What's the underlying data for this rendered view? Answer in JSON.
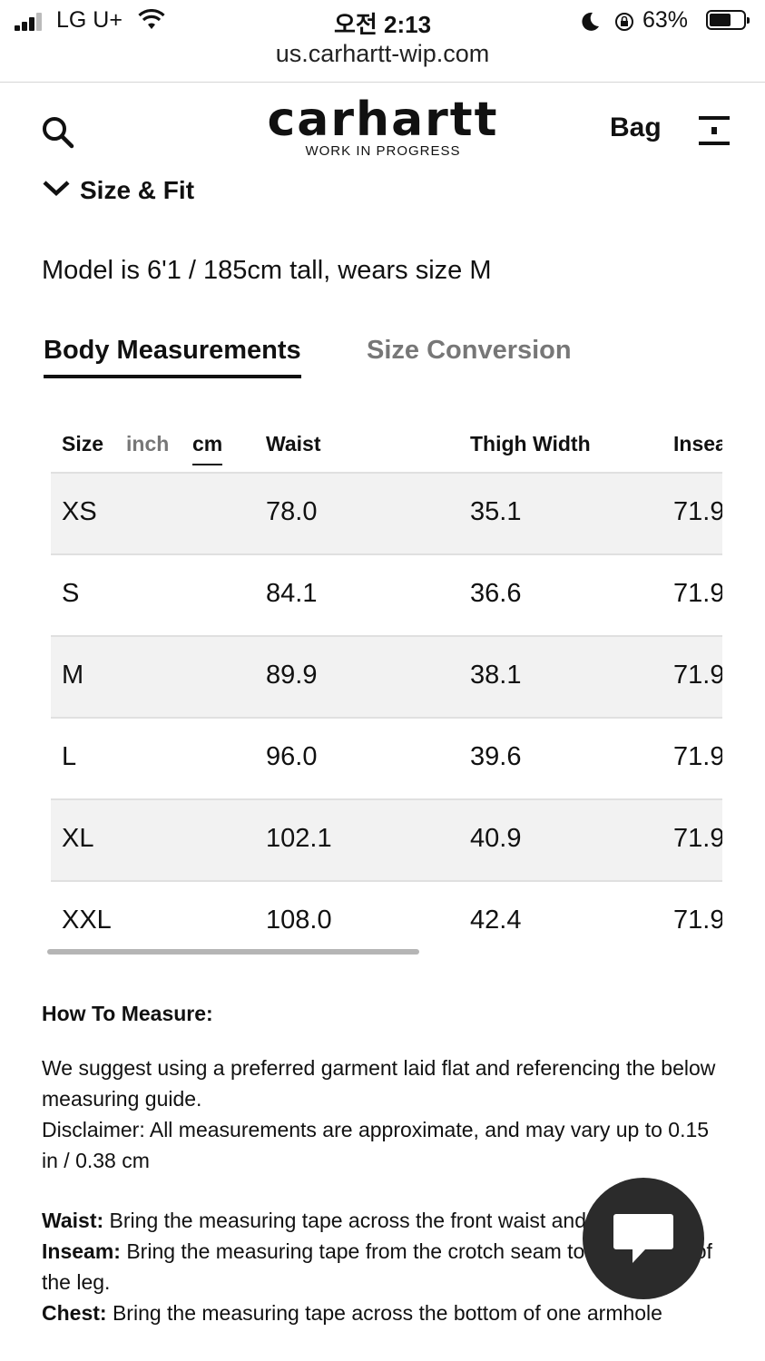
{
  "status_bar": {
    "carrier": "LG U+",
    "time": "오전 2:13",
    "battery_percent": "63%",
    "battery_level": 0.63
  },
  "browser": {
    "url": "us.carhartt-wip.com"
  },
  "header": {
    "logo_text": "carhartt",
    "logo_subtitle": "WORK IN PROGRESS",
    "bag_label": "Bag",
    "icons": {
      "search": "search-icon",
      "menu": "hamburger-menu-icon"
    }
  },
  "section": {
    "title": "Size & Fit"
  },
  "model_info": "Model is 6'1 / 185cm tall, wears size M",
  "tabs": [
    {
      "label": "Body Measurements",
      "active": true
    },
    {
      "label": "Size Conversion",
      "active": false
    }
  ],
  "table": {
    "size_label": "Size",
    "units": [
      {
        "label": "inch",
        "active": false
      },
      {
        "label": "cm",
        "active": true
      }
    ],
    "columns": [
      "Waist",
      "Thigh Width",
      "Inseam"
    ],
    "rows": [
      {
        "size": "XS",
        "waist": "78.0",
        "thigh": "35.1",
        "inseam": "71.9"
      },
      {
        "size": "S",
        "waist": "84.1",
        "thigh": "36.6",
        "inseam": "71.9"
      },
      {
        "size": "M",
        "waist": "89.9",
        "thigh": "38.1",
        "inseam": "71.9"
      },
      {
        "size": "L",
        "waist": "96.0",
        "thigh": "39.6",
        "inseam": "71.9"
      },
      {
        "size": "XL",
        "waist": "102.1",
        "thigh": "40.9",
        "inseam": "71.9"
      },
      {
        "size": "XXL",
        "waist": "108.0",
        "thigh": "42.4",
        "inseam": "71.9"
      }
    ]
  },
  "how_to_measure": {
    "title": "How To Measure:",
    "intro": "We suggest using a preferred garment laid flat and referencing the below measuring guide.",
    "disclaimer": "Disclaimer: All measurements are approximate, and may vary up to 0.15 in / 0.38 cm",
    "items": [
      {
        "term": "Waist:",
        "text": "Bring the measuring tape across the front waist and double it."
      },
      {
        "term": "Inseam:",
        "text": "Bring the measuring tape from the crotch seam to the bottom of the leg."
      },
      {
        "term": "Chest:",
        "text": "Bring the measuring tape across the bottom of one armhole"
      }
    ]
  },
  "chat": {
    "icon": "chat-bubble-icon"
  },
  "colors": {
    "text": "#111111",
    "muted": "#777777",
    "row_alt": "#f2f2f2",
    "chat_bg": "#2b2b2b"
  }
}
